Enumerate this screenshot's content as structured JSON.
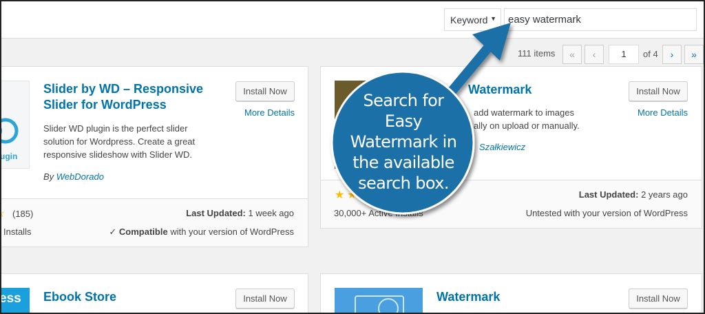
{
  "search": {
    "type_label": "Keyword",
    "query": "easy watermark"
  },
  "pagination": {
    "items_count": "111 items",
    "first": "«",
    "prev": "‹",
    "current_page": "1",
    "of_pages": "of 4",
    "next": "›",
    "last": "»"
  },
  "plugins": [
    {
      "title_line1": "Slider by WD – Responsive",
      "title_line2": "Slider for WordPress",
      "install_label": "Install Now",
      "more_details": "More Details",
      "description": [
        "Slider WD plugin is the perfect slider",
        "solution for Wordpress. Create a great",
        "responsive slideshow with Slider WD."
      ],
      "author_prefix": "By ",
      "author": "WebDorado",
      "logo_text": "ugin",
      "rating_count": "(185)",
      "installs": "Installs",
      "last_updated_label": "Last Updated:",
      "last_updated_value": "1 week ago",
      "compat_check": "✓",
      "compat_bold": "Compatible",
      "compat_rest": "with your version of WordPress"
    },
    {
      "title": "Watermark",
      "install_label": "Install Now",
      "more_details": "More Details",
      "description": [
        "add watermark to images",
        "ally on upload or manually."
      ],
      "author": "Szałkiewicz",
      "installs": "30,000+ Active Installs",
      "last_updated_label": "Last Updated:",
      "last_updated_value": "2 years ago",
      "compat_text": "Untested with your version of WordPress"
    },
    {
      "title": "Ebook Store",
      "install_label": "Install Now",
      "logo_text": "ess"
    },
    {
      "title": "Watermark",
      "install_label": "Install Now"
    }
  ],
  "callout": {
    "lines": [
      "Search for",
      "Easy",
      "Watermark in",
      "the available",
      "search box."
    ],
    "color": "#1f6fa8"
  }
}
